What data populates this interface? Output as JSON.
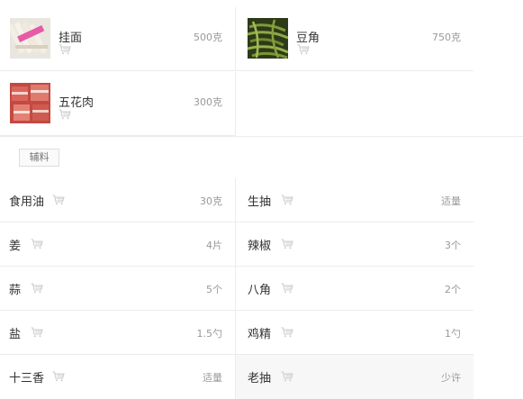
{
  "main_ingredients": [
    {
      "name": "挂面",
      "qty": "500克",
      "photo": "noodles-photo"
    },
    {
      "name": "豆角",
      "qty": "750克",
      "photo": "green-beans-photo"
    },
    {
      "name": "五花肉",
      "qty": "300克",
      "photo": "pork-belly-photo"
    }
  ],
  "auxiliary_label": "辅料",
  "auxiliary": [
    {
      "name": "食用油",
      "qty": "30克"
    },
    {
      "name": "生抽",
      "qty": "适量"
    },
    {
      "name": "姜",
      "qty": "4片"
    },
    {
      "name": "辣椒",
      "qty": "3个"
    },
    {
      "name": "蒜",
      "qty": "5个"
    },
    {
      "name": "八角",
      "qty": "2个"
    },
    {
      "name": "盐",
      "qty": "1.5勺"
    },
    {
      "name": "鸡精",
      "qty": "1勺"
    },
    {
      "name": "十三香",
      "qty": "适量"
    },
    {
      "name": "老抽",
      "qty": "少许"
    }
  ],
  "icons": {
    "cart": "shopping-cart-icon"
  },
  "colors": {
    "border": "#ececec",
    "text": "#333333",
    "muted": "#999999",
    "cart": "#cccccc"
  }
}
